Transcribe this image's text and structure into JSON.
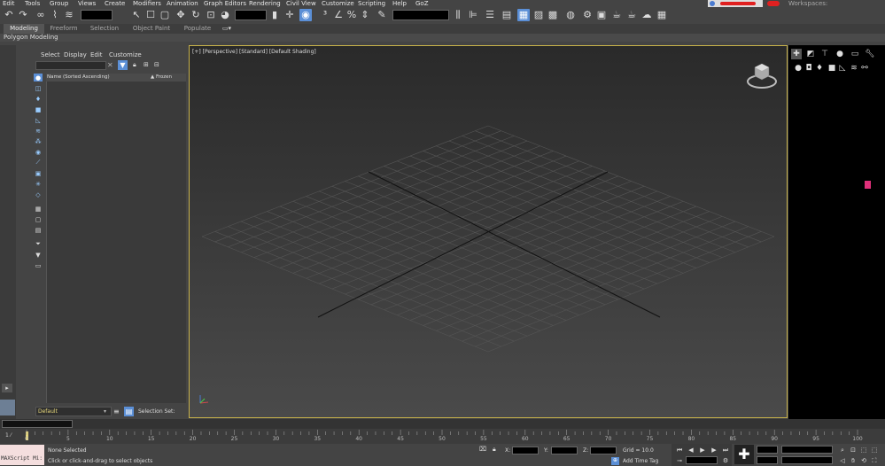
{
  "menubar": {
    "items": [
      "Edit",
      "Tools",
      "Group",
      "Views",
      "Create",
      "Modifiers",
      "Animation",
      "Graph Editors",
      "Rendering",
      "Civil View",
      "Customize",
      "Scripting",
      "Help",
      "GoZ"
    ],
    "workspaces_label": "Workspaces:"
  },
  "ribbon": {
    "tabs": [
      "Modeling",
      "Freeform",
      "Selection",
      "Object Paint",
      "Populate"
    ],
    "active_tab": "Modeling",
    "sub_label": "Polygon Modeling"
  },
  "explorer": {
    "menu": [
      "Select",
      "Display",
      "Edit",
      "Customize"
    ],
    "column_name": "Name (Sorted Ascending)",
    "column_frozen": "▲ Frozen",
    "layer_value": "Default",
    "selection_set_label": "Selection Set:"
  },
  "viewport": {
    "label": "[+] [Perspective] [Standard] [Default Shading]"
  },
  "timeline": {
    "frame_label": "0 / 100",
    "ticks": [
      "0",
      "5",
      "10",
      "15",
      "20",
      "25",
      "30",
      "35",
      "40",
      "45",
      "50",
      "55",
      "60",
      "65",
      "70",
      "75",
      "80",
      "85",
      "90",
      "95",
      "100"
    ]
  },
  "status": {
    "maxscript": "MAXScript Mi:",
    "selection": "None Selected",
    "prompt": "Click or click-and-drag to select objects",
    "x_label": "X:",
    "y_label": "Y:",
    "z_label": "Z:",
    "grid": "Grid = 10.0",
    "add_time_tag": "Add Time Tag"
  },
  "colors": {
    "accent": "#5b8fd6",
    "viewport_border": "#c7b14a",
    "marker": "#e0307a"
  }
}
